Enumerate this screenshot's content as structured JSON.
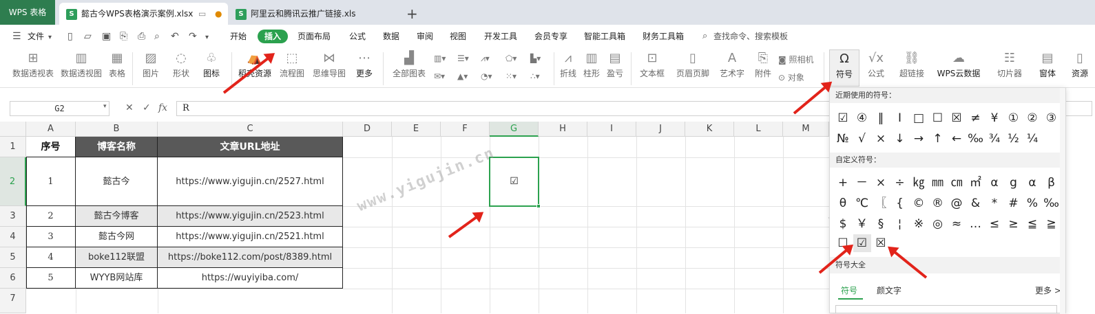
{
  "tabs": {
    "app": "WPS 表格",
    "file1": "懿古今WPS表格演示案例.xlsx",
    "file1_badge": "S",
    "file2": "阿里云和腾讯云推广链接.xls",
    "file2_badge": "S",
    "add": "+"
  },
  "menu": {
    "file": "文件",
    "items": [
      "开始",
      "插入",
      "页面布局",
      "公式",
      "数据",
      "审阅",
      "视图",
      "开发工具",
      "会员专享",
      "智能工具箱",
      "财务工具箱"
    ],
    "search": "查找命令、搜索模板"
  },
  "ribbon": {
    "pivot_table": "数据透视表",
    "pivot_chart": "数据透视图",
    "table": "表格",
    "picture": "图片",
    "shape": "形状",
    "icon": "图标",
    "resources": "稻壳资源",
    "flowchart": "流程图",
    "mindmap": "思维导图",
    "more": "更多",
    "all_charts": "全部图表",
    "line": "折线",
    "column": "柱形",
    "winloss": "盈亏",
    "textbox": "文本框",
    "header_footer": "页眉页脚",
    "wordart": "艺术字",
    "attachment": "附件",
    "camera": "照相机",
    "object": "对象",
    "symbol": "符号",
    "equation": "公式",
    "hyperlink": "超链接",
    "wps_cloud": "WPS云数据",
    "slicer": "切片器",
    "window": "窗体",
    "resource2": "资源"
  },
  "formula_bar": {
    "name_box": "G2",
    "formula": "R",
    "fx": "fx"
  },
  "columns": [
    "A",
    "B",
    "C",
    "D",
    "E",
    "F",
    "G",
    "H",
    "I",
    "J",
    "K",
    "L",
    "M"
  ],
  "rows": [
    "1",
    "2",
    "3",
    "4",
    "5",
    "6",
    "7"
  ],
  "table": {
    "headers": [
      "序号",
      "博客名称",
      "文章URL地址"
    ],
    "data": [
      [
        "1",
        "懿古今",
        "https://www.yigujin.cn/2527.html"
      ],
      [
        "2",
        "懿古今博客",
        "https://www.yigujin.cn/2523.html"
      ],
      [
        "3",
        "懿古今网",
        "https://www.yigujin.cn/2521.html"
      ],
      [
        "4",
        "boke112联盟",
        "https://boke112.com/post/8389.html"
      ],
      [
        "5",
        "WYYB网站库",
        "https://wuyiyiba.com/"
      ]
    ]
  },
  "g2_value": "☑",
  "panel": {
    "recent_title": "近期使用的符号：",
    "recent_row1": [
      "☑",
      "④",
      "‖",
      "Ⅰ",
      "□",
      "☐",
      "☒",
      "≠",
      "¥",
      "①",
      "②",
      "③"
    ],
    "recent_row2": [
      "№",
      "√",
      "×",
      "↓",
      "→",
      "↑",
      "←",
      "‰",
      "¾",
      "½",
      "¼"
    ],
    "custom_title": "自定义符号：",
    "custom_row1": [
      "+",
      "－",
      "×",
      "÷",
      "㎏",
      "㎜",
      "㎝",
      "㎡",
      "α",
      "g",
      "α",
      "β"
    ],
    "custom_row2": [
      "θ",
      "℃",
      "〖",
      "{",
      "©",
      "®",
      "@",
      "&",
      "*",
      "#",
      "%",
      "‰"
    ],
    "custom_row3": [
      "$",
      "￥",
      "§",
      "¦",
      "※",
      "◎",
      "≈",
      "…",
      "≤",
      "≥",
      "≦",
      "≧"
    ],
    "custom_row4": [
      "☐",
      "☑",
      "☒"
    ],
    "all_title": "符号大全",
    "tab_symbol": "符号",
    "tab_emoticon": "颜文字",
    "more": "更多 >"
  },
  "watermark": "www.yigujin.cn",
  "colors": {
    "accent": "#2ba14e",
    "header_dark": "#595959",
    "arrow": "#e2231a"
  }
}
